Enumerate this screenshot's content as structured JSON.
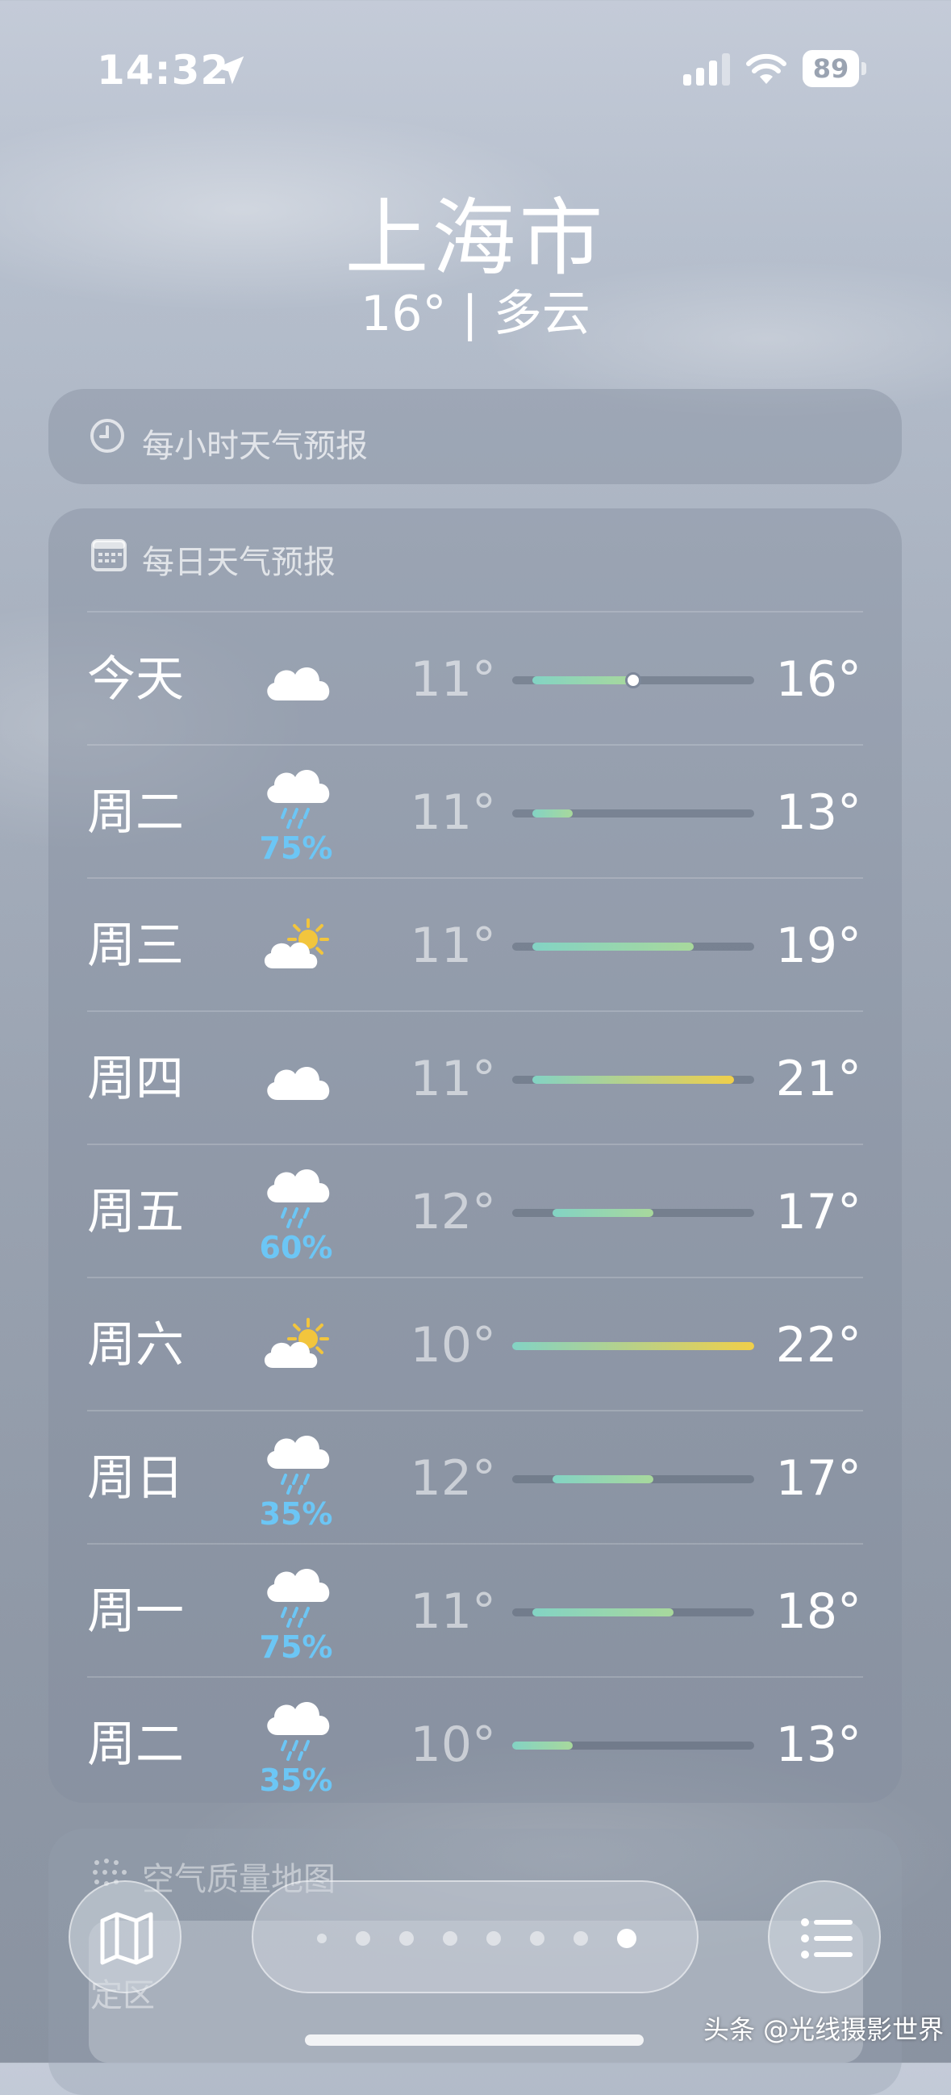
{
  "status_bar": {
    "time": "14:32",
    "battery": "89"
  },
  "header": {
    "city": "上海市",
    "summary": "16° | 多云"
  },
  "hourly": {
    "title": "每小时天气预报"
  },
  "daily": {
    "title": "每日天气预报",
    "scale": {
      "min": 10,
      "max": 22
    },
    "current_temp": 16,
    "colors": {
      "cool": "#83d3c4",
      "mild": "#a8d89c",
      "warm": "#f0cf4a",
      "precip": "#6cc6f5"
    },
    "rows": [
      {
        "day": "今天",
        "icon": "cloud-icon",
        "precip": "",
        "low": "11°",
        "high": "16°",
        "low_val": 11,
        "high_val": 16
      },
      {
        "day": "周二",
        "icon": "rain-cloud-icon",
        "precip": "75%",
        "low": "11°",
        "high": "13°",
        "low_val": 11,
        "high_val": 13
      },
      {
        "day": "周三",
        "icon": "partly-sunny-icon",
        "precip": "",
        "low": "11°",
        "high": "19°",
        "low_val": 11,
        "high_val": 19
      },
      {
        "day": "周四",
        "icon": "cloud-icon",
        "precip": "",
        "low": "11°",
        "high": "21°",
        "low_val": 11,
        "high_val": 21
      },
      {
        "day": "周五",
        "icon": "rain-cloud-icon",
        "precip": "60%",
        "low": "12°",
        "high": "17°",
        "low_val": 12,
        "high_val": 17
      },
      {
        "day": "周六",
        "icon": "partly-sunny-icon",
        "precip": "",
        "low": "10°",
        "high": "22°",
        "low_val": 10,
        "high_val": 22
      },
      {
        "day": "周日",
        "icon": "rain-cloud-icon",
        "precip": "35%",
        "low": "12°",
        "high": "17°",
        "low_val": 12,
        "high_val": 17
      },
      {
        "day": "周一",
        "icon": "rain-cloud-icon",
        "precip": "75%",
        "low": "11°",
        "high": "18°",
        "low_val": 11,
        "high_val": 18
      },
      {
        "day": "周二",
        "icon": "rain-cloud-icon",
        "precip": "35%",
        "low": "10°",
        "high": "13°",
        "low_val": 10,
        "high_val": 13
      }
    ]
  },
  "air_quality": {
    "title": "空气质量地图",
    "label": "定区"
  },
  "bottom_bar": {
    "map_icon": "map-icon",
    "list_icon": "list-icon",
    "page_count": 8,
    "active_page": 8
  },
  "watermark": "头条 @光线摄影世界"
}
